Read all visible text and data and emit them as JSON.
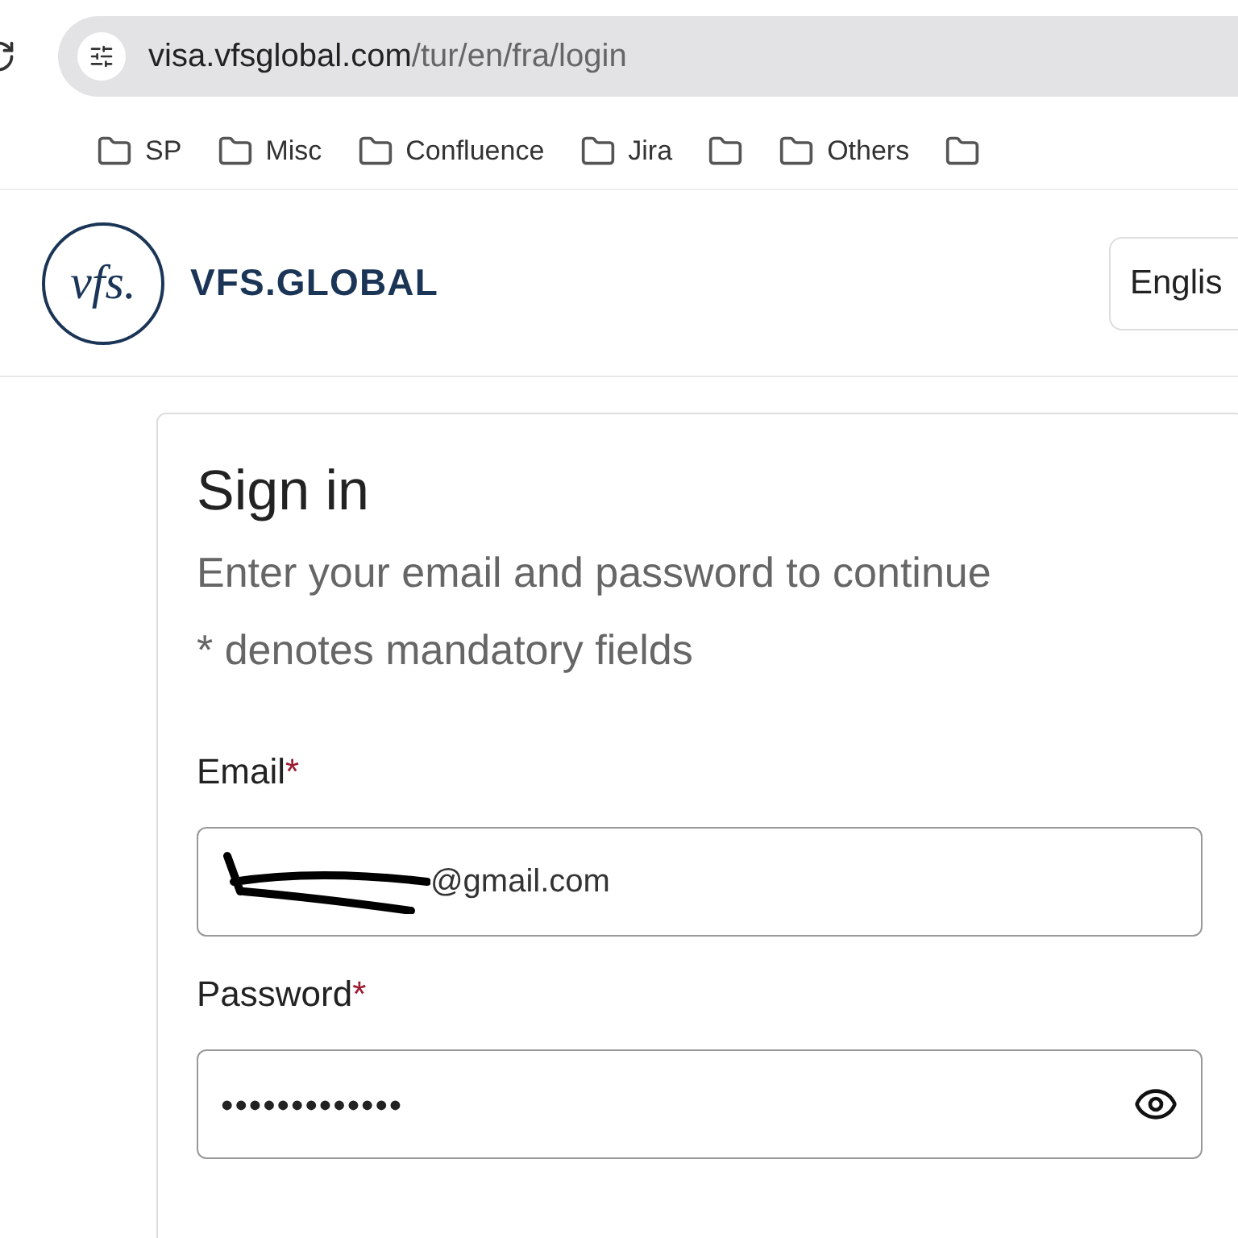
{
  "browser": {
    "url_host": "visa.vfsglobal.com",
    "url_path": "/tur/en/fra/login",
    "bookmarks": [
      {
        "kind": "folder",
        "label": "SP"
      },
      {
        "kind": "folder",
        "label": "Misc"
      },
      {
        "kind": "folder",
        "label": "Confluence"
      },
      {
        "kind": "folder",
        "label": "Jira"
      },
      {
        "kind": "folder"
      },
      {
        "kind": "folder",
        "label": "Others"
      },
      {
        "kind": "folder"
      }
    ]
  },
  "header": {
    "brand": "VFS.GLOBAL",
    "logo_text": "vfs.",
    "language": "Englis"
  },
  "form": {
    "title": "Sign in",
    "subtitle": "Enter your email and password to continue",
    "note": "* denotes mandatory fields",
    "fields": [
      {
        "kind": "email",
        "label": "Email",
        "required_mark": "*",
        "value": "@gmail.com",
        "redacted": true
      },
      {
        "kind": "password",
        "label": "Password",
        "required_mark": "*",
        "value": "•••••••••••••",
        "redacted": false
      }
    ]
  }
}
